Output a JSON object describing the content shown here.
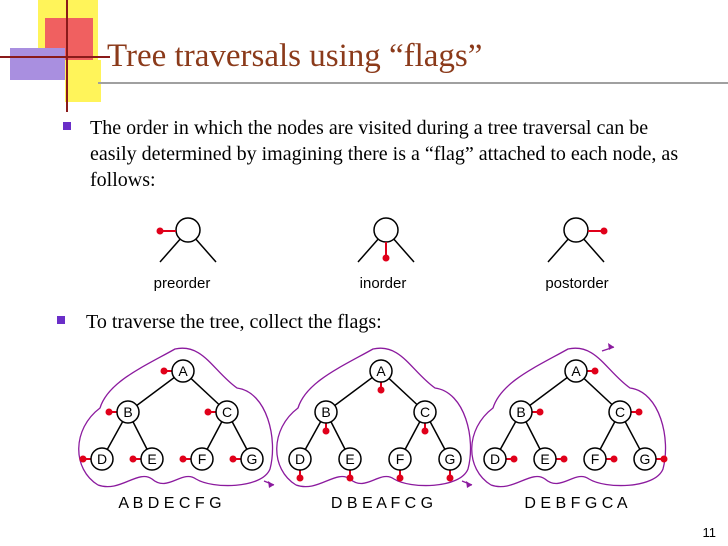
{
  "title": "Tree traversals using “flags”",
  "bullets": [
    "The order in which the nodes are visited during a tree traversal can be easily determined by imagining there is a “flag” attached to each node, as follows:",
    "To traverse the tree, collect the flags:"
  ],
  "flag_examples": [
    {
      "label": "preorder"
    },
    {
      "label": "inorder"
    },
    {
      "label": "postorder"
    }
  ],
  "tree_nodes": [
    "A",
    "B",
    "C",
    "D",
    "E",
    "F",
    "G"
  ],
  "sequences": [
    "A B D E C F G",
    "D B E A F C G",
    "D E B F G C A"
  ],
  "page_number": "11",
  "colors": {
    "title": "#8B3A1A",
    "bullet": "#6A2EC8",
    "flag": "#E0001A",
    "path": "#8B1A9E",
    "deco_red": "#F06060",
    "deco_yellow": "#FFF45A",
    "deco_purple": "#A98FE0"
  }
}
